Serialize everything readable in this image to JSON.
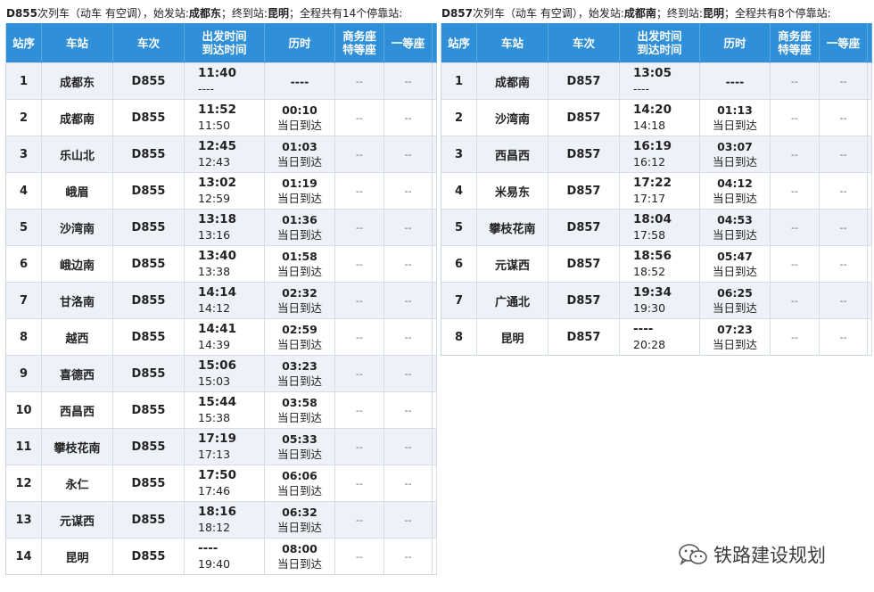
{
  "left": {
    "title_code": "D855",
    "title_a": "次列车（动车 有空调），始发站:",
    "origin": "成都东",
    "title_b": "；终到站:",
    "terminus": "昆明",
    "title_c": "；全程共有14个停靠站:",
    "headers": [
      "站序",
      "车站",
      "车次",
      "出发时间",
      "到达时间",
      "历时",
      "商务座",
      "特等座",
      "一等座"
    ],
    "rows": [
      {
        "seq": "1",
        "station": "成都东",
        "code": "D855",
        "dep": "11:40",
        "arr": "----",
        "dur": "----",
        "day": "",
        "b1": "--",
        "b2": "--"
      },
      {
        "seq": "2",
        "station": "成都南",
        "code": "D855",
        "dep": "11:52",
        "arr": "11:50",
        "dur": "00:10",
        "day": "当日到达",
        "b1": "--",
        "b2": "--"
      },
      {
        "seq": "3",
        "station": "乐山北",
        "code": "D855",
        "dep": "12:45",
        "arr": "12:43",
        "dur": "01:03",
        "day": "当日到达",
        "b1": "--",
        "b2": "--"
      },
      {
        "seq": "4",
        "station": "峨眉",
        "code": "D855",
        "dep": "13:02",
        "arr": "12:59",
        "dur": "01:19",
        "day": "当日到达",
        "b1": "--",
        "b2": "--"
      },
      {
        "seq": "5",
        "station": "沙湾南",
        "code": "D855",
        "dep": "13:18",
        "arr": "13:16",
        "dur": "01:36",
        "day": "当日到达",
        "b1": "--",
        "b2": "--"
      },
      {
        "seq": "6",
        "station": "峨边南",
        "code": "D855",
        "dep": "13:40",
        "arr": "13:38",
        "dur": "01:58",
        "day": "当日到达",
        "b1": "--",
        "b2": "--"
      },
      {
        "seq": "7",
        "station": "甘洛南",
        "code": "D855",
        "dep": "14:14",
        "arr": "14:12",
        "dur": "02:32",
        "day": "当日到达",
        "b1": "--",
        "b2": "--"
      },
      {
        "seq": "8",
        "station": "越西",
        "code": "D855",
        "dep": "14:41",
        "arr": "14:39",
        "dur": "02:59",
        "day": "当日到达",
        "b1": "--",
        "b2": "--"
      },
      {
        "seq": "9",
        "station": "喜德西",
        "code": "D855",
        "dep": "15:06",
        "arr": "15:03",
        "dur": "03:23",
        "day": "当日到达",
        "b1": "--",
        "b2": "--"
      },
      {
        "seq": "10",
        "station": "西昌西",
        "code": "D855",
        "dep": "15:44",
        "arr": "15:38",
        "dur": "03:58",
        "day": "当日到达",
        "b1": "--",
        "b2": "--"
      },
      {
        "seq": "11",
        "station": "攀枝花南",
        "code": "D855",
        "dep": "17:19",
        "arr": "17:13",
        "dur": "05:33",
        "day": "当日到达",
        "b1": "--",
        "b2": "--"
      },
      {
        "seq": "12",
        "station": "永仁",
        "code": "D855",
        "dep": "17:50",
        "arr": "17:46",
        "dur": "06:06",
        "day": "当日到达",
        "b1": "--",
        "b2": "--"
      },
      {
        "seq": "13",
        "station": "元谋西",
        "code": "D855",
        "dep": "18:16",
        "arr": "18:12",
        "dur": "06:32",
        "day": "当日到达",
        "b1": "--",
        "b2": "--"
      },
      {
        "seq": "14",
        "station": "昆明",
        "code": "D855",
        "dep": "----",
        "arr": "19:40",
        "dur": "08:00",
        "day": "当日到达",
        "b1": "--",
        "b2": "--"
      }
    ]
  },
  "right": {
    "title_code": "D857",
    "title_a": "次列车（动车 有空调），始发站:",
    "origin": "成都南",
    "title_b": "；终到站:",
    "terminus": "昆明",
    "title_c": "；全程共有8个停靠站:",
    "headers": [
      "站序",
      "车站",
      "车次",
      "出发时间",
      "到达时间",
      "历时",
      "商务座",
      "特等座",
      "一等座"
    ],
    "rows": [
      {
        "seq": "1",
        "station": "成都南",
        "code": "D857",
        "dep": "13:05",
        "arr": "----",
        "dur": "----",
        "day": "",
        "b1": "--",
        "b2": "--"
      },
      {
        "seq": "2",
        "station": "沙湾南",
        "code": "D857",
        "dep": "14:20",
        "arr": "14:18",
        "dur": "01:13",
        "day": "当日到达",
        "b1": "--",
        "b2": "--"
      },
      {
        "seq": "3",
        "station": "西昌西",
        "code": "D857",
        "dep": "16:19",
        "arr": "16:12",
        "dur": "03:07",
        "day": "当日到达",
        "b1": "--",
        "b2": "--"
      },
      {
        "seq": "4",
        "station": "米易东",
        "code": "D857",
        "dep": "17:22",
        "arr": "17:17",
        "dur": "04:12",
        "day": "当日到达",
        "b1": "--",
        "b2": "--"
      },
      {
        "seq": "5",
        "station": "攀枝花南",
        "code": "D857",
        "dep": "18:04",
        "arr": "17:58",
        "dur": "04:53",
        "day": "当日到达",
        "b1": "--",
        "b2": "--"
      },
      {
        "seq": "6",
        "station": "元谋西",
        "code": "D857",
        "dep": "18:56",
        "arr": "18:52",
        "dur": "05:47",
        "day": "当日到达",
        "b1": "--",
        "b2": "--"
      },
      {
        "seq": "7",
        "station": "广通北",
        "code": "D857",
        "dep": "19:34",
        "arr": "19:30",
        "dur": "06:25",
        "day": "当日到达",
        "b1": "--",
        "b2": "--"
      },
      {
        "seq": "8",
        "station": "昆明",
        "code": "D857",
        "dep": "----",
        "arr": "20:28",
        "dur": "07:23",
        "day": "当日到达",
        "b1": "--",
        "b2": "--"
      }
    ]
  },
  "watermark": {
    "text": "铁路建设规划",
    "icon": "wechat-icon"
  },
  "colors": {
    "header": "#2f8fd8",
    "row_alt": "#eef2f8"
  }
}
